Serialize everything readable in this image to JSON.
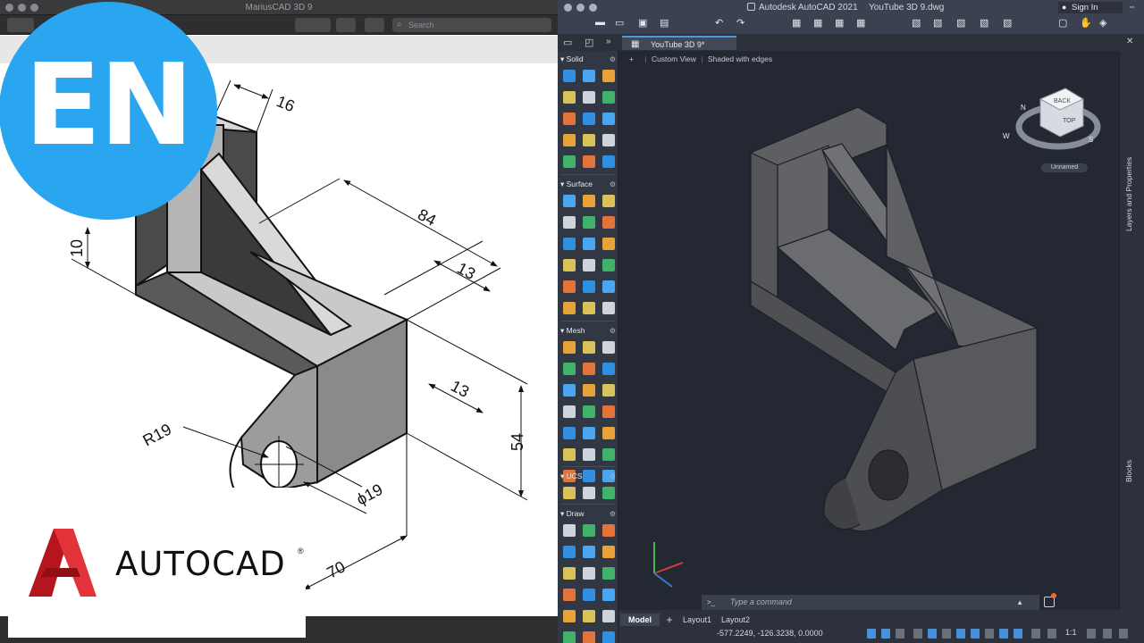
{
  "left_window": {
    "title": "MariusCAD 3D 9",
    "search_placeholder": "Search"
  },
  "overlay": {
    "badge": "EN",
    "brand": "AUTOCAD",
    "registered": "®",
    "brand_red": "#d3222a",
    "badge_color": "#2aa6f0"
  },
  "drawing": {
    "dimensions": [
      "16",
      "84",
      "13",
      "13",
      "10",
      "54",
      "70",
      "R19",
      "ϕ19"
    ]
  },
  "autocad": {
    "app_title": "Autodesk AutoCAD 2021",
    "file_title": "YouTube 3D 9.dwg",
    "sign_in": "Sign In",
    "doc_tab": "YouTube 3D 9*",
    "viewport_controls": {
      "minus": "+",
      "view": "Custom View",
      "visual_style": "Shaded with edges"
    },
    "viewcube": {
      "top": "TOP",
      "back": "BACK",
      "north": "N",
      "west": "W",
      "south": "S",
      "ucs": "Unnamed"
    },
    "palette_sections": [
      "Solid",
      "Surface",
      "Mesh",
      "UCS",
      "Draw"
    ],
    "right_panels": [
      "Layers and Properties",
      "Blocks"
    ],
    "command_placeholder": "Type a command",
    "command_prompt": ">_",
    "tabs": [
      "Model",
      "Layout1",
      "Layout2"
    ],
    "add_tab": "+",
    "coordinates": "-577.2249, -126.3238, 0.0000",
    "scale": "1:1"
  }
}
